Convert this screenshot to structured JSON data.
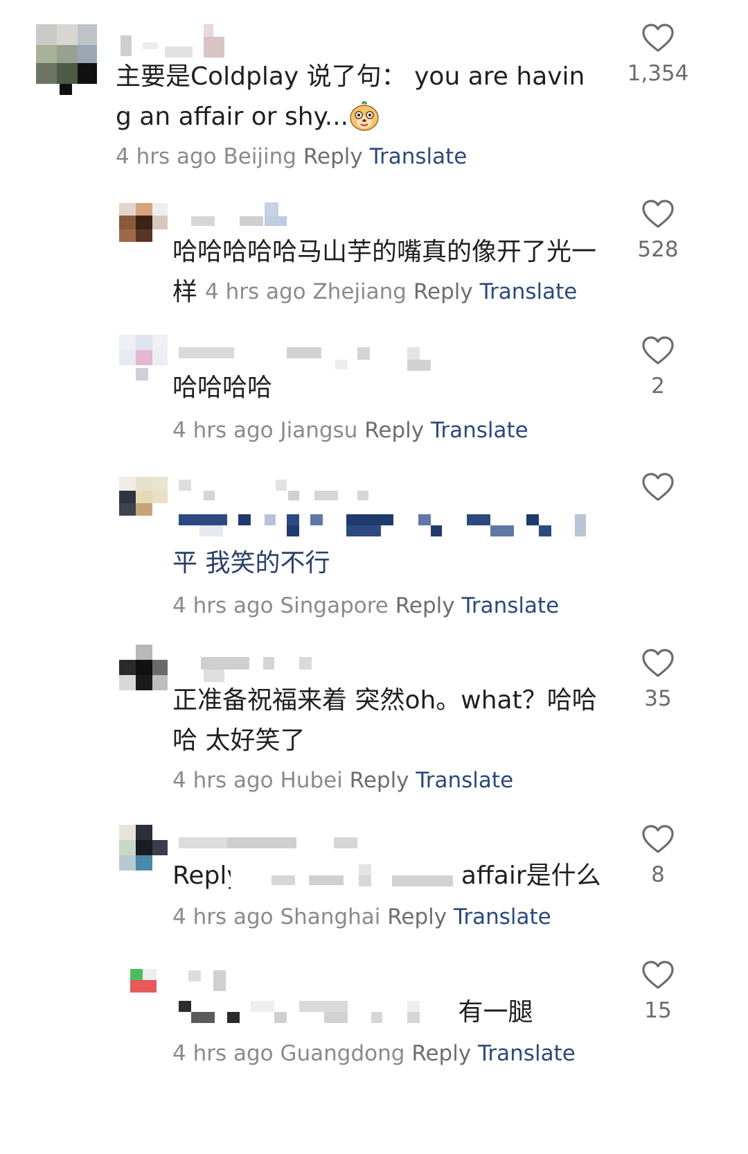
{
  "comments": [
    {
      "text": "主要是Coldplay 说了句：  you are having an affair or shy...",
      "time": "4 hrs ago",
      "location": "Beijing",
      "reply_label": "Reply",
      "translate_label": "Translate",
      "likes": "1,354",
      "emoji": "meerkat-emoji-icon"
    },
    {
      "text": "哈哈哈哈哈马山芋的嘴真的像开了光一样",
      "time": "4 hrs ago",
      "location": "Zhejiang",
      "reply_label": "Reply",
      "translate_label": "Translate",
      "likes": "528"
    },
    {
      "text": "哈哈哈哈",
      "time": "4 hrs ago",
      "location": "Jiangsu",
      "reply_label": "Reply",
      "translate_label": "Translate",
      "likes": "2"
    },
    {
      "text": "平 我笑的不行",
      "time": "4 hrs ago",
      "location": "Singapore",
      "reply_label": "Reply",
      "translate_label": "Translate",
      "likes": ""
    },
    {
      "text": "正准备祝福来着 突然oh。what？哈哈哈 太好笑了",
      "time": "4 hrs ago",
      "location": "Hubei",
      "reply_label": "Reply",
      "translate_label": "Translate",
      "likes": "35"
    },
    {
      "text_prefix": "Reply",
      "text_suffix": "affair是什么",
      "time": "4 hrs ago",
      "location": "Shanghai",
      "reply_label": "Reply",
      "translate_label": "Translate",
      "likes": "8"
    },
    {
      "text_suffix": "有一腿",
      "time": "4 hrs ago",
      "location": "Guangdong",
      "reply_label": "Reply",
      "translate_label": "Translate",
      "likes": "15"
    }
  ],
  "colors": {
    "translate": "#2b4a7a",
    "meta": "#8a8a8a",
    "heart": "#6b6b6b"
  },
  "icons": {
    "like": "heart-outline-icon"
  }
}
